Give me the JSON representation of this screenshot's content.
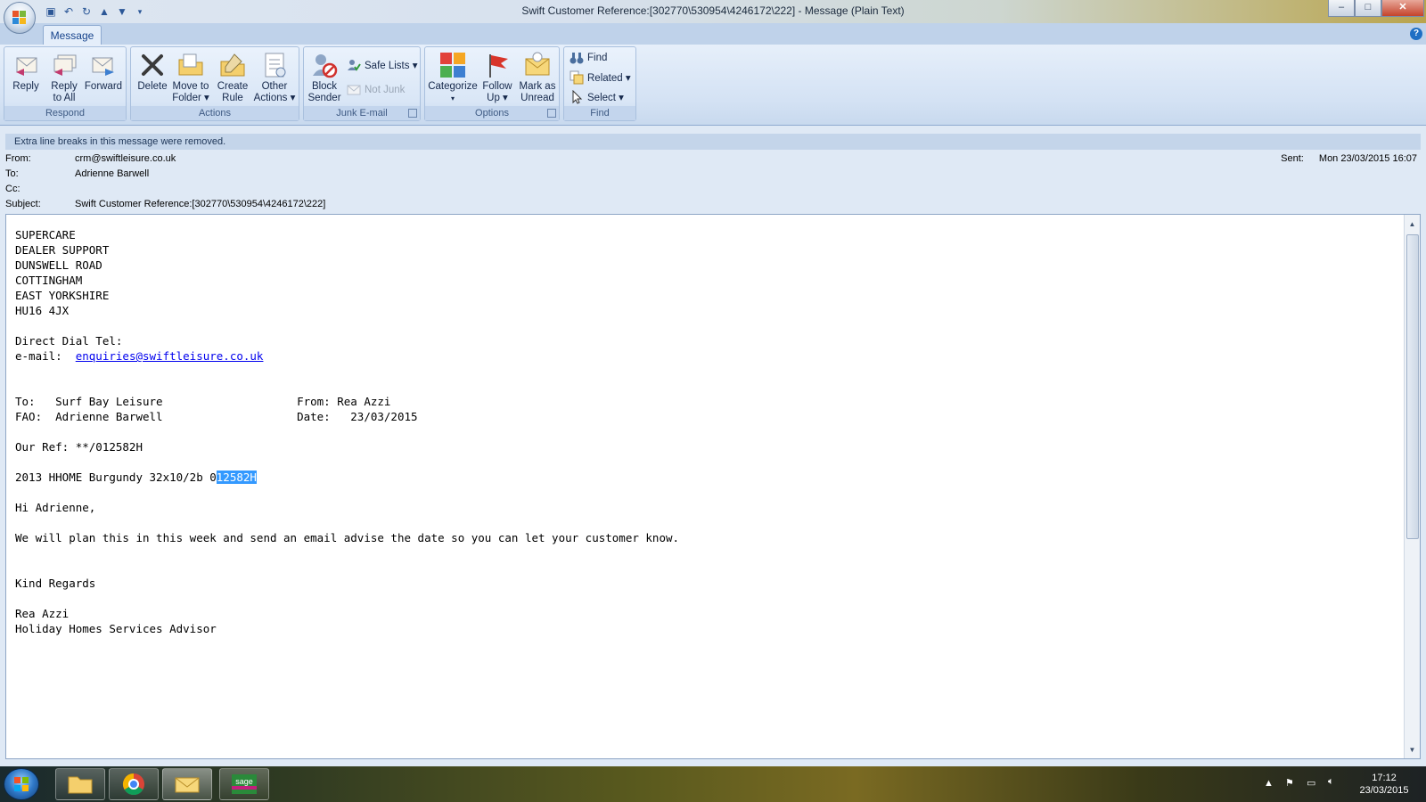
{
  "window": {
    "title": "Swift Customer Reference:[302770\\530954\\4246172\\222] - Message (Plain Text)",
    "controls": {
      "minimize": "–",
      "maximize": "□",
      "close": "✕"
    }
  },
  "ribbon": {
    "active_tab": "Message",
    "groups": {
      "respond": {
        "label": "Respond",
        "reply": "Reply",
        "reply_all_1": "Reply",
        "reply_all_2": "to All",
        "forward": "Forward"
      },
      "actions": {
        "label": "Actions",
        "delete": "Delete",
        "move_1": "Move to",
        "move_2": "Folder ▾",
        "create_1": "Create",
        "create_2": "Rule",
        "other_1": "Other",
        "other_2": "Actions ▾"
      },
      "junk": {
        "label": "Junk E-mail",
        "block_1": "Block",
        "block_2": "Sender",
        "safe_lists": "Safe Lists ▾",
        "not_junk": "Not Junk"
      },
      "options": {
        "label": "Options",
        "categorize": "Categorize",
        "categorize_arrow": "▾",
        "follow_1": "Follow",
        "follow_2": "Up ▾",
        "mark_1": "Mark as",
        "mark_2": "Unread"
      },
      "find": {
        "label": "Find",
        "find": "Find",
        "related": "Related ▾",
        "select": "Select ▾"
      }
    }
  },
  "infobar": "Extra line breaks in this message were removed.",
  "header": {
    "from_label": "From:",
    "from": "crm@swiftleisure.co.uk",
    "to_label": "To:",
    "to": "Adrienne Barwell",
    "cc_label": "Cc:",
    "cc": "",
    "subject_label": "Subject:",
    "subject": "Swift Customer Reference:[302770\\530954\\4246172\\222]",
    "sent_label": "Sent:",
    "sent": "Mon 23/03/2015 16:07"
  },
  "body": {
    "lines_top": "SUPERCARE\nDEALER SUPPORT\nDUNSWELL ROAD\nCOTTINGHAM\nEAST YORKSHIRE\nHU16 4JX\n\nDirect Dial Tel:\ne-mail:  ",
    "email_link": "enquiries@swiftleisure.co.uk",
    "lines_mid": "\n\n\nTo:   Surf Bay Leisure                    From: Rea Azzi\nFAO:  Adrienne Barwell                    Date:   23/03/2015\n\nOur Ref: **/012582H\n\n2013 HHOME Burgundy 32x10/2b 0",
    "highlight": "12582H",
    "lines_bottom": "\n\nHi Adrienne,\n\nWe will plan this in this week and send an email advise the date so you can let your customer know.\n\n\nKind Regards\n\nRea Azzi\nHoliday Homes Services Advisor"
  },
  "taskbar": {
    "time": "17:12",
    "date": "23/03/2015"
  }
}
